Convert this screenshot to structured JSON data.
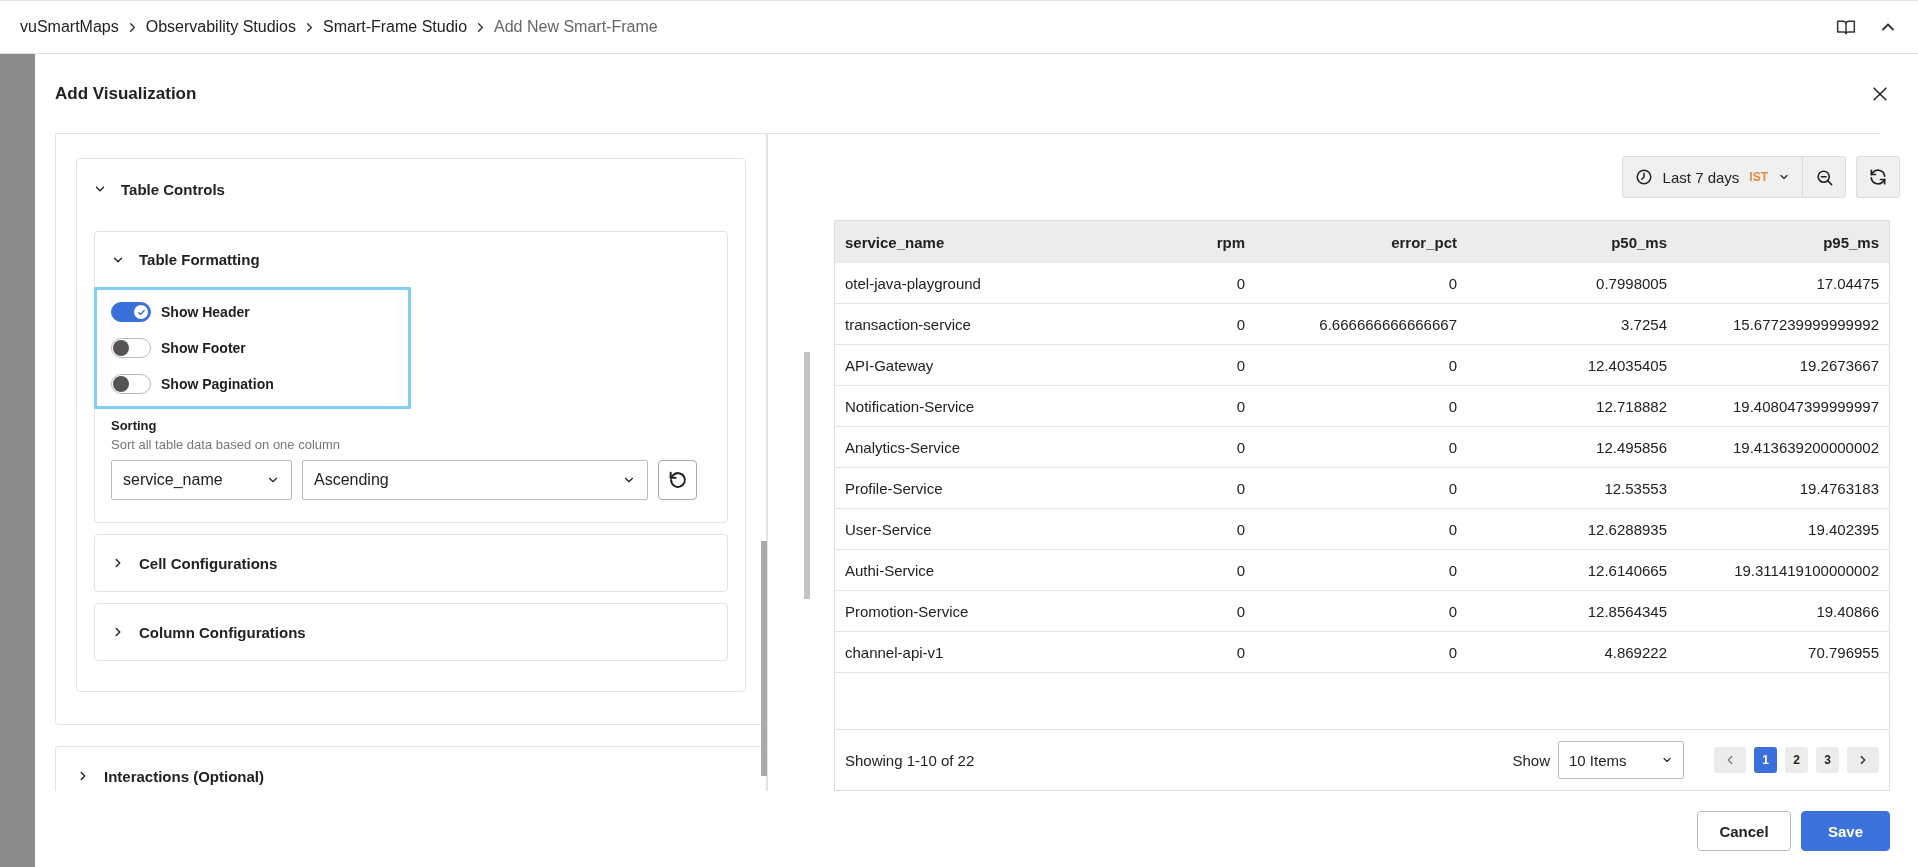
{
  "breadcrumb": [
    {
      "label": "vuSmartMaps",
      "current": false
    },
    {
      "label": "Observability Studios",
      "current": false
    },
    {
      "label": "Smart-Frame Studio",
      "current": false
    },
    {
      "label": "Add New Smart-Frame",
      "current": true
    }
  ],
  "dialog": {
    "title": "Add Visualization"
  },
  "table_controls": {
    "title": "Table Controls",
    "expanded": true,
    "formatting": {
      "title": "Table Formatting",
      "expanded": true,
      "toggles": [
        {
          "label": "Show Header",
          "on": true
        },
        {
          "label": "Show Footer",
          "on": false
        },
        {
          "label": "Show Pagination",
          "on": false
        }
      ]
    },
    "sorting": {
      "label": "Sorting",
      "hint": "Sort all table data based on one column",
      "column": "service_name",
      "order": "Ascending"
    },
    "sections": [
      {
        "title": "Cell Configurations",
        "expanded": false
      },
      {
        "title": "Column Configurations",
        "expanded": false
      }
    ]
  },
  "interactions": {
    "title": "Interactions (Optional)",
    "expanded": false
  },
  "time_range": {
    "label": "Last 7 days",
    "timezone": "IST"
  },
  "table": {
    "columns": [
      {
        "label": "service_name",
        "kind": "text"
      },
      {
        "label": "rpm",
        "kind": "number"
      },
      {
        "label": "error_pct",
        "kind": "number"
      },
      {
        "label": "p50_ms",
        "kind": "number"
      },
      {
        "label": "p95_ms",
        "kind": "number"
      }
    ],
    "rows": [
      [
        "otel-java-playground",
        "0",
        "0",
        "0.7998005",
        "17.04475"
      ],
      [
        "transaction-service",
        "0",
        "6.666666666666667",
        "3.7254",
        "15.677239999999992"
      ],
      [
        "API-Gateway",
        "0",
        "0",
        "12.4035405",
        "19.2673667"
      ],
      [
        "Notification-Service",
        "0",
        "0",
        "12.718882",
        "19.408047399999997"
      ],
      [
        "Analytics-Service",
        "0",
        "0",
        "12.495856",
        "19.413639200000002"
      ],
      [
        "Profile-Service",
        "0",
        "0",
        "12.53553",
        "19.4763183"
      ],
      [
        "User-Service",
        "0",
        "0",
        "12.6288935",
        "19.402395"
      ],
      [
        "Authi-Service",
        "0",
        "0",
        "12.6140665",
        "19.311419100000002"
      ],
      [
        "Promotion-Service",
        "0",
        "0",
        "12.8564345",
        "19.40866"
      ],
      [
        "channel-api-v1",
        "0",
        "0",
        "4.869222",
        "70.796955"
      ]
    ]
  },
  "pagination": {
    "summary": "Showing 1-10 of 22",
    "show_label": "Show",
    "page_size": "10 Items",
    "pages": [
      {
        "label": "1",
        "selected": true
      },
      {
        "label": "2",
        "selected": false
      },
      {
        "label": "3",
        "selected": false
      }
    ]
  },
  "buttons": [
    {
      "label": "Cancel",
      "kind": "secondary"
    },
    {
      "label": "Save",
      "kind": "primary"
    }
  ]
}
